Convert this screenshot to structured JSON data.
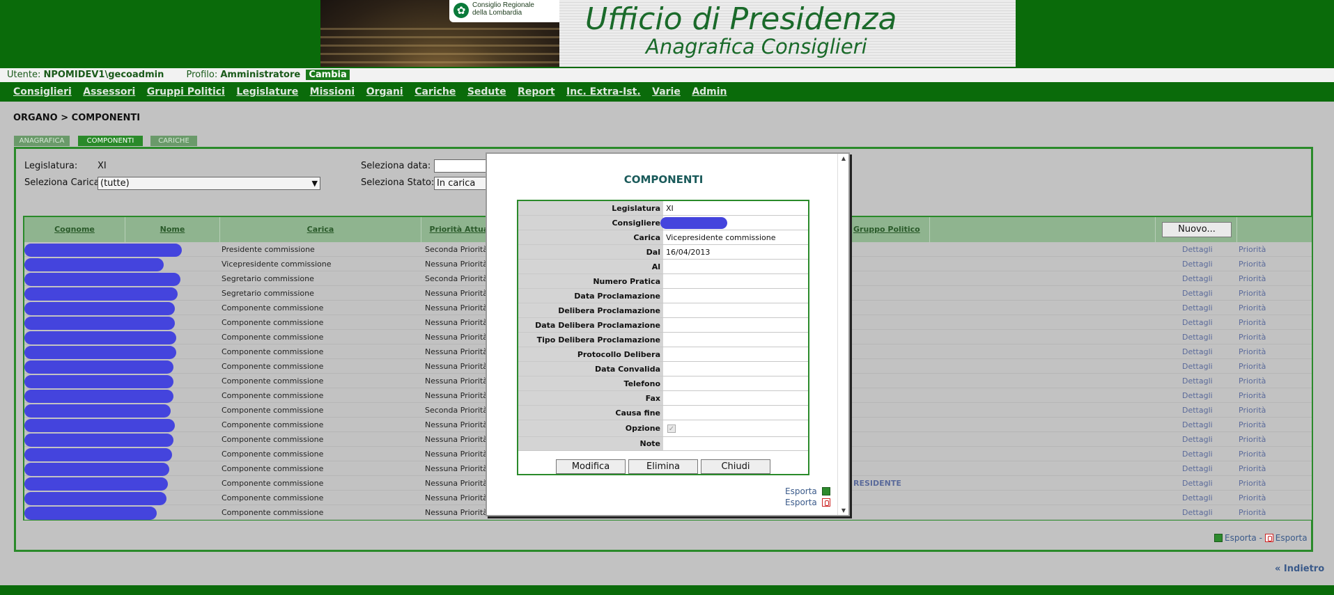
{
  "header": {
    "title": "Ufficio di Presidenza",
    "subtitle": "Anagrafica Consiglieri",
    "logo_line1": "Consiglio Regionale",
    "logo_line2": "della Lombardia"
  },
  "userbar": {
    "utente_label": "Utente:",
    "utente_value": "NPOMIDEV1\\gecoadmin",
    "profilo_label": "Profilo:",
    "profilo_value": "Amministratore",
    "cambia": "Cambia"
  },
  "nav": [
    "Consiglieri",
    "Assessori",
    "Gruppi Politici",
    "Legislature",
    "Missioni",
    "Organi",
    "Cariche",
    "Sedute",
    "Report",
    "Inc. Extra-Ist.",
    "Varie",
    "Admin"
  ],
  "breadcrumb": "ORGANO > COMPONENTI",
  "tabs": [
    "ANAGRAFICA",
    "COMPONENTI",
    "CARICHE"
  ],
  "filters": {
    "legislatura_label": "Legislatura:",
    "legislatura_value": "XI",
    "carica_label": "Seleziona Carica:",
    "carica_value": "(tutte)",
    "data_label": "Seleziona data:",
    "data_value": "",
    "stato_label": "Seleziona Stato:",
    "stato_value": "In carica"
  },
  "grid": {
    "headers": [
      "Cognome",
      "Nome",
      "Carica",
      "Priorità Attuale",
      "Gruppo Politico"
    ],
    "nuovo": "Nuovo...",
    "dettagli": "Dettagli",
    "priorita": "Priorità",
    "rows": [
      {
        "carica": "Presidente commissione",
        "priorita": "Seconda Priorità",
        "gruppo": ""
      },
      {
        "carica": "Vicepresidente commissione",
        "priorita": "Nessuna Priorità",
        "gruppo": ""
      },
      {
        "carica": "Segretario commissione",
        "priorita": "Seconda Priorità",
        "gruppo": ""
      },
      {
        "carica": "Segretario commissione",
        "priorita": "Nessuna Priorità",
        "gruppo": ""
      },
      {
        "carica": "Componente commissione",
        "priorita": "Nessuna Priorità",
        "gruppo": ""
      },
      {
        "carica": "Componente commissione",
        "priorita": "Nessuna Priorità",
        "gruppo": ""
      },
      {
        "carica": "Componente commissione",
        "priorita": "Nessuna Priorità",
        "gruppo": ""
      },
      {
        "carica": "Componente commissione",
        "priorita": "Nessuna Priorità",
        "gruppo": ""
      },
      {
        "carica": "Componente commissione",
        "priorita": "Nessuna Priorità",
        "gruppo": ""
      },
      {
        "carica": "Componente commissione",
        "priorita": "Nessuna Priorità",
        "gruppo": ""
      },
      {
        "carica": "Componente commissione",
        "priorita": "Nessuna Priorità",
        "gruppo": ""
      },
      {
        "carica": "Componente commissione",
        "priorita": "Seconda Priorità",
        "gruppo": ""
      },
      {
        "carica": "Componente commissione",
        "priorita": "Nessuna Priorità",
        "gruppo": ""
      },
      {
        "carica": "Componente commissione",
        "priorita": "Nessuna Priorità",
        "gruppo": ""
      },
      {
        "carica": "Componente commissione",
        "priorita": "Nessuna Priorità",
        "gruppo": ""
      },
      {
        "carica": "Componente commissione",
        "priorita": "Nessuna Priorità",
        "gruppo": ""
      },
      {
        "carica": "Componente commissione",
        "priorita": "Nessuna Priorità",
        "gruppo": "RESIDENTE"
      },
      {
        "carica": "Componente commissione",
        "priorita": "Nessuna Priorità",
        "gruppo": ""
      },
      {
        "carica": "Componente commissione",
        "priorita": "Nessuna Priorità",
        "gruppo": ""
      }
    ]
  },
  "export": {
    "label": "Esporta",
    "sep": "-"
  },
  "indietro": "« Indietro",
  "modal": {
    "title": "COMPONENTI",
    "fields": [
      {
        "label": "Legislatura",
        "value": "XI"
      },
      {
        "label": "Consigliere",
        "value": ""
      },
      {
        "label": "Carica",
        "value": "Vicepresidente commissione"
      },
      {
        "label": "Dal",
        "value": "16/04/2013"
      },
      {
        "label": "Al",
        "value": ""
      },
      {
        "label": "Numero Pratica",
        "value": ""
      },
      {
        "label": "Data Proclamazione",
        "value": ""
      },
      {
        "label": "Delibera Proclamazione",
        "value": ""
      },
      {
        "label": "Data Delibera Proclamazione",
        "value": ""
      },
      {
        "label": "Tipo Delibera Proclamazione",
        "value": ""
      },
      {
        "label": "Protocollo Delibera Proclamazione",
        "value": ""
      },
      {
        "label": "Data Convalida",
        "value": ""
      },
      {
        "label": "Telefono",
        "value": ""
      },
      {
        "label": "Fax",
        "value": ""
      },
      {
        "label": "Causa fine",
        "value": ""
      },
      {
        "label": "Opzione",
        "value": ""
      },
      {
        "label": "Note",
        "value": ""
      }
    ],
    "buttons": [
      "Modifica",
      "Elimina",
      "Chiudi"
    ],
    "export_label": "Esporta"
  }
}
